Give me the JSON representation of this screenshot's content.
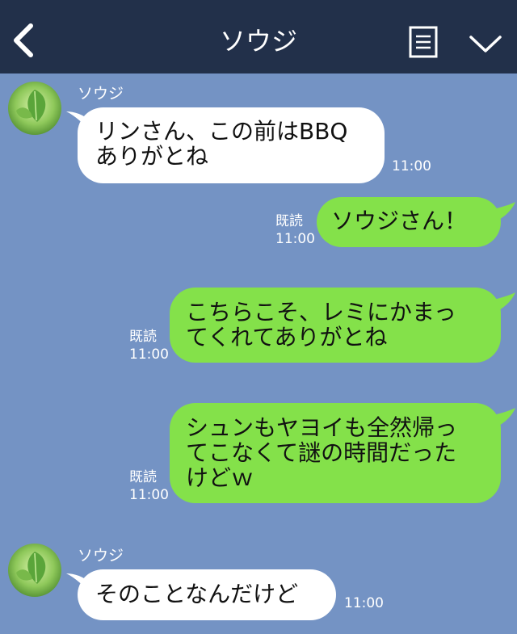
{
  "header": {
    "title": "ソウジ"
  },
  "messages": [
    {
      "dir": "in",
      "sender": "ソウジ",
      "lines": [
        "リンさん、この前はBBQ",
        "ありがとね"
      ],
      "time": "11:00"
    },
    {
      "dir": "out",
      "read": "既読",
      "lines": [
        "ソウジさん！"
      ],
      "time": "11:00"
    },
    {
      "dir": "out",
      "read": "既読",
      "lines": [
        "こちらこそ、レミにかまっ",
        "てくれてありがとね"
      ],
      "time": "11:00"
    },
    {
      "dir": "out",
      "read": "既読",
      "lines": [
        "シュンもヤヨイも全然帰っ",
        "てこなくて謎の時間だった",
        "けどｗ"
      ],
      "time": "11:00"
    },
    {
      "dir": "in",
      "sender": "ソウジ",
      "lines": [
        "そのことなんだけど"
      ],
      "time": "11:00"
    }
  ],
  "colors": {
    "header_bg": "#22304a",
    "chat_bg": "#7493c4",
    "out_bubble": "#84e14a",
    "in_bubble": "#ffffff"
  },
  "icons": [
    "back-arrow-icon",
    "menu-icon",
    "chevron-down-icon",
    "leaf-avatar"
  ]
}
